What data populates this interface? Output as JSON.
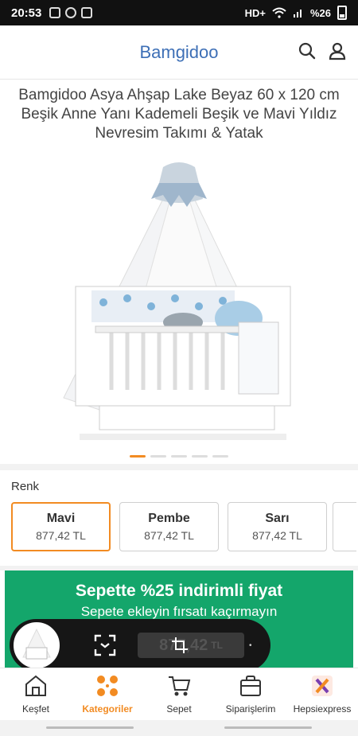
{
  "status_bar": {
    "time": "20:53",
    "network": "HD+",
    "battery_percent": "%26"
  },
  "header": {
    "brand": "Bamgidoo",
    "icons": [
      "search-icon",
      "user-icon"
    ]
  },
  "product": {
    "title": "Bamgidoo Asya Ahşap Lake Beyaz 60 x 120 cm Beşik Anne Yanı Kademeli Beşik ve Mavi Yıldız Nevresim Takımı & Yatak",
    "carousel_count": 5,
    "carousel_active": 0
  },
  "variants": {
    "label": "Renk",
    "options": [
      {
        "name": "Mavi",
        "price": "877,42 TL",
        "selected": true
      },
      {
        "name": "Pembe",
        "price": "877,42 TL",
        "selected": false
      },
      {
        "name": "Sarı",
        "price": "877,42 TL",
        "selected": false
      }
    ]
  },
  "promo": {
    "title": "Sepette %25 indirimli fiyat",
    "subtitle": "Sepete ekleyin fırsatı kaçırmayın"
  },
  "floating_overlay": {
    "price": "877,42",
    "currency": "TL"
  },
  "bottom_nav": {
    "items": [
      {
        "label": "Keşfet",
        "icon": "home-icon",
        "active": false
      },
      {
        "label": "Kategoriler",
        "icon": "categories-icon",
        "active": true
      },
      {
        "label": "Sepet",
        "icon": "cart-icon",
        "active": false
      },
      {
        "label": "Siparişlerim",
        "icon": "orders-icon",
        "active": false
      },
      {
        "label": "Hepsiexpress",
        "icon": "hepsiexpress-icon",
        "active": false
      }
    ]
  },
  "colors": {
    "accent": "#f28b22",
    "brand": "#3d6fb6",
    "promo_bg": "#14a66b"
  }
}
